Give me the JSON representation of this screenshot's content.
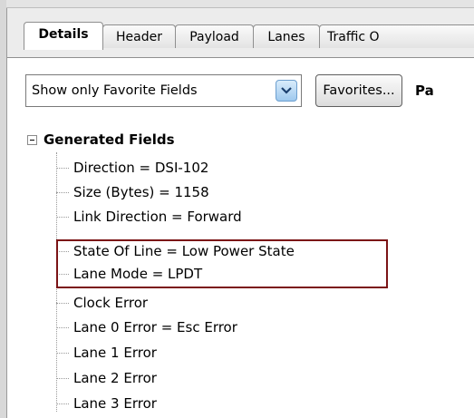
{
  "tabs": [
    {
      "label": "Details",
      "active": true
    },
    {
      "label": "Header",
      "active": false
    },
    {
      "label": "Payload",
      "active": false
    },
    {
      "label": "Lanes",
      "active": false
    },
    {
      "label": "Traffic O",
      "active": false
    }
  ],
  "toolbar": {
    "filter_dropdown_value": "Show only Favorite Fields",
    "favorites_button_label": "Favorites...",
    "partial_label": "Pa"
  },
  "tree": {
    "root_label": "Generated Fields",
    "items": [
      "Direction = DSI-102",
      "Size (Bytes) = 1158",
      "Link Direction = Forward",
      "State Of Line = Low Power State",
      "Lane Mode = LPDT",
      "Clock Error",
      "Lane 0 Error = Esc Error",
      "Lane 1 Error",
      "Lane 2 Error",
      "Lane 3 Error"
    ]
  },
  "colors": {
    "highlight_border": "#7b1416",
    "dropdown_arrow": "#9fc9ee"
  }
}
